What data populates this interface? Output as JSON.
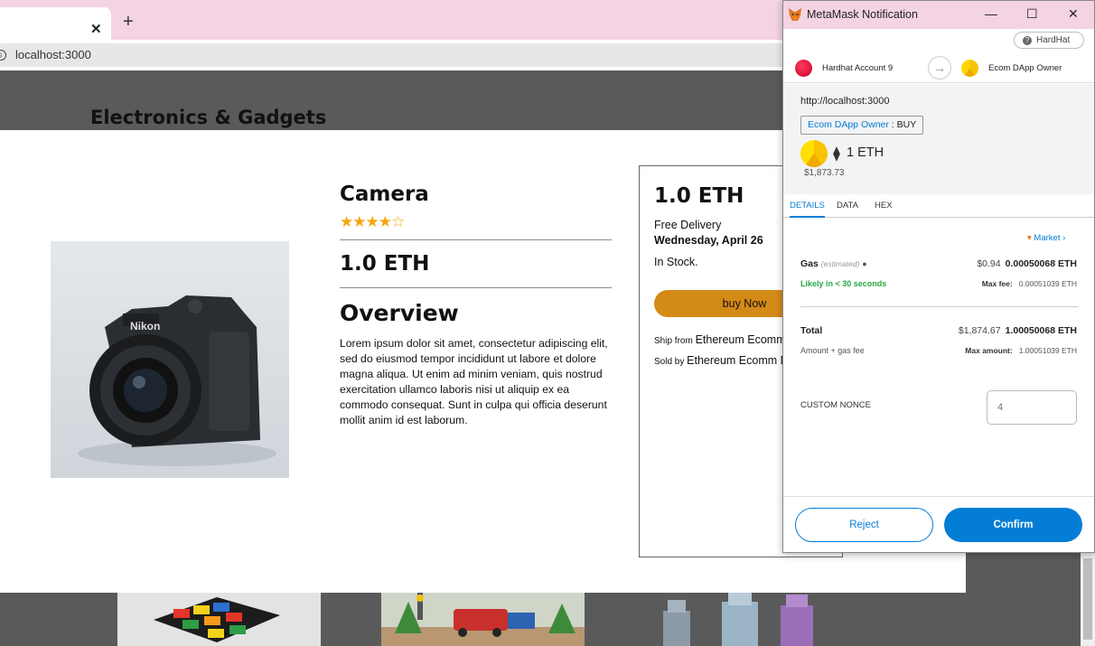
{
  "browser": {
    "tab_close": "✕",
    "new_tab": "+",
    "url": "localhost:3000"
  },
  "page": {
    "heading": "Electronics & Gadgets"
  },
  "product": {
    "title": "Camera",
    "rating": 4,
    "rating_max": 5,
    "price": "1.0 ETH",
    "overview_heading": "Overview",
    "overview_text": "Lorem ipsum dolor sit amet, consectetur adipiscing elit, sed do eiusmod tempor incididunt ut labore et dolore magna aliqua. Ut enim ad minim veniam, quis nostrud exercitation ullamco laboris nisi ut aliquip ex ea commodo consequat. Sunt in culpa qui officia deserunt mollit anim id est laborum."
  },
  "order": {
    "price": "1.0 ETH",
    "delivery": "Free Delivery",
    "delivery_date": "Wednesday, April 26",
    "stock": "In Stock.",
    "buy_label": "buy Now",
    "ship_label": "Ship from",
    "ship_value": "Ethereum Ecomm",
    "sold_label": "Sold by",
    "sold_value": "Ethereum Ecomm D"
  },
  "metamask": {
    "window_title": "MetaMask Notification",
    "minimize": "—",
    "maximize": "☐",
    "close": "✕",
    "network": "HardHat",
    "network_icon": "?",
    "from_account": "Hardhat Account 9",
    "to_account": "Ecom DApp Owner",
    "arrow": "→",
    "origin": "http://localhost:3000",
    "method_target": "Ecom DApp Owner",
    "method_sep": " : ",
    "method_name": "BUY",
    "amount": "1 ETH",
    "amount_fiat": "$1,873.73",
    "tabs": [
      "DETAILS",
      "DATA",
      "HEX"
    ],
    "market": "Market",
    "gas_label": "Gas",
    "gas_estimated": "(estimated)",
    "gas_fiat": "$0.94",
    "gas_eth": "0.00050068 ETH",
    "likely": "Likely in < 30 seconds",
    "max_fee_label": "Max fee:",
    "max_fee_value": "0.00051039 ETH",
    "total_label": "Total",
    "total_fiat": "$1,874.67",
    "total_eth": "1.00050068 ETH",
    "amount_gas_label": "Amount + gas fee",
    "max_amount_label": "Max amount:",
    "max_amount_value": "1.00051039 ETH",
    "nonce_label": "CUSTOM NONCE",
    "nonce_placeholder": "4",
    "reject": "Reject",
    "confirm": "Confirm",
    "colors": {
      "primary": "#037dd6",
      "success": "#28a745",
      "buy_button": "#d48a17",
      "star": "#f3a710"
    }
  }
}
